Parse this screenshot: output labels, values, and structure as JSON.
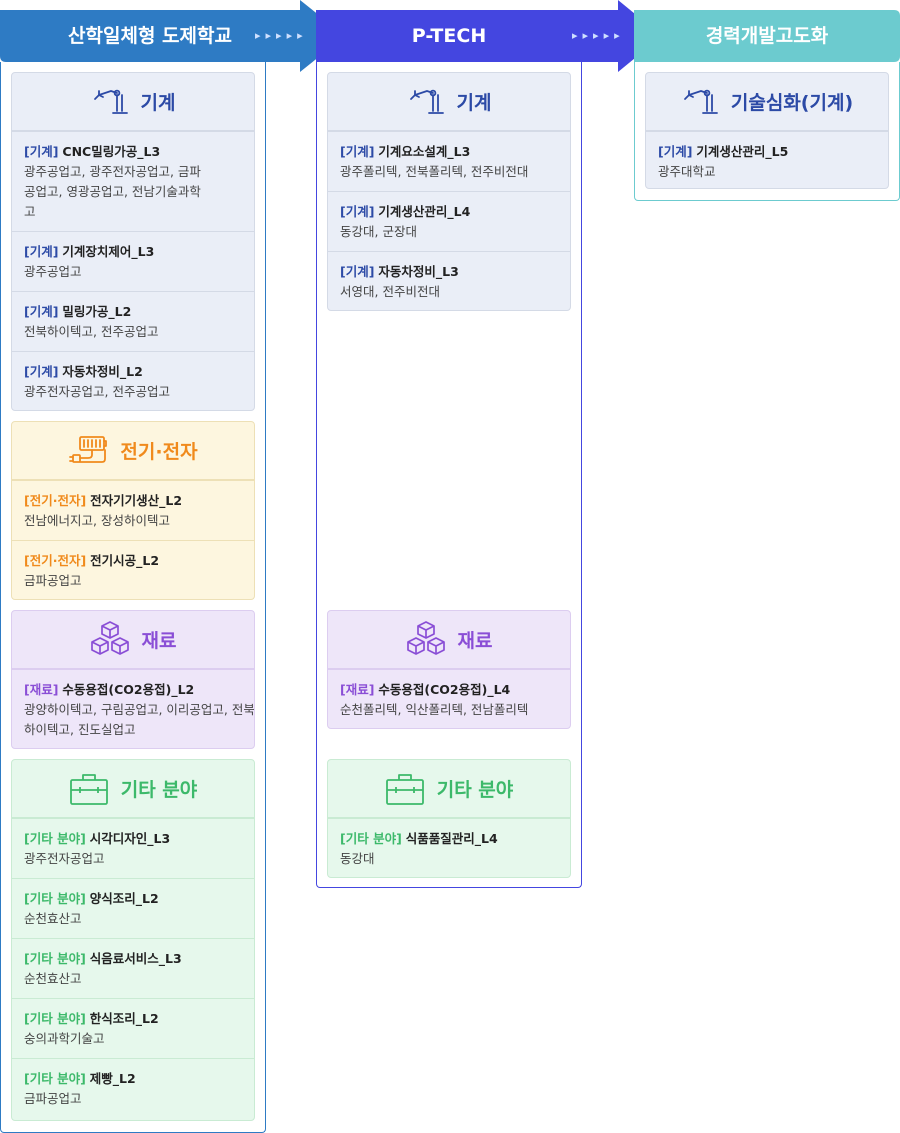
{
  "headers": [
    {
      "label": "산학일체형 도제학교",
      "color": "#2e7bc4"
    },
    {
      "label": "P-TECH",
      "color": "#4446e0"
    },
    {
      "label": "경력개발고도화",
      "color": "#6ccbcf"
    }
  ],
  "arrow_dots": "▸▸▸▸▸",
  "columns": [
    {
      "cards": [
        {
          "category": "기계",
          "icon": "robot-arm-icon",
          "items": [
            {
              "tag": "[기계]",
              "name": "CNC밀링가공_L3",
              "schools": "광주공업고, 광주전자공업고, 금파공업고, 영광공업고, 전남기술과학고"
            },
            {
              "tag": "[기계]",
              "name": "기계장치제어_L3",
              "schools": "광주공업고"
            },
            {
              "tag": "[기계]",
              "name": "밀링가공_L2",
              "schools": "전북하이텍고, 전주공업고"
            },
            {
              "tag": "[기계]",
              "name": "자동차정비_L2",
              "schools": "광주전자공업고, 전주공업고"
            }
          ]
        },
        {
          "category": "전기·전자",
          "icon": "battery-plug-icon",
          "items": [
            {
              "tag": "[전기·전자]",
              "name": "전자기기생산_L2",
              "schools": "전남에너지고, 장성하이텍고"
            },
            {
              "tag": "[전기·전자]",
              "name": "전기시공_L2",
              "schools": "금파공업고"
            }
          ]
        },
        {
          "category": "재료",
          "icon": "cubes-icon",
          "items": [
            {
              "tag": "[재료]",
              "name": "수동용접(CO2용접)_L2",
              "schools": "광양하이텍고, 구림공업고, 이리공업고, 전북하이텍고, 진도실업고"
            }
          ]
        },
        {
          "category": "기타 분야",
          "icon": "toolbox-icon",
          "items": [
            {
              "tag": "[기타 분야]",
              "name": "시각디자인_L3",
              "schools": "광주전자공업고"
            },
            {
              "tag": "[기타 분야]",
              "name": "양식조리_L2",
              "schools": "순천효산고"
            },
            {
              "tag": "[기타 분야]",
              "name": "식음료서비스_L3",
              "schools": "순천효산고"
            },
            {
              "tag": "[기타 분야]",
              "name": "한식조리_L2",
              "schools": "숭의과학기술고"
            },
            {
              "tag": "[기타 분야]",
              "name": "제빵_L2",
              "schools": "금파공업고"
            }
          ]
        }
      ]
    },
    {
      "cards": [
        {
          "category": "기계",
          "icon": "robot-arm-icon",
          "items": [
            {
              "tag": "[기계]",
              "name": "기계요소설계_L3",
              "schools": "광주폴리텍, 전북폴리텍, 전주비전대"
            },
            {
              "tag": "[기계]",
              "name": "기계생산관리_L4",
              "schools": "동강대, 군장대"
            },
            {
              "tag": "[기계]",
              "name": "자동차정비_L3",
              "schools": "서영대, 전주비전대"
            }
          ]
        },
        {
          "category": "재료",
          "icon": "cubes-icon",
          "items": [
            {
              "tag": "[재료]",
              "name": "수동용접(CO2용접)_L4",
              "schools": "순천폴리텍, 익산폴리텍, 전남폴리텍"
            }
          ]
        },
        {
          "category": "기타 분야",
          "icon": "toolbox-icon",
          "items": [
            {
              "tag": "[기타 분야]",
              "name": "식품품질관리_L4",
              "schools": "동강대"
            }
          ]
        }
      ]
    },
    {
      "cards": [
        {
          "category": "기술심화(기계)",
          "icon": "robot-arm-icon",
          "items": [
            {
              "tag": "[기계]",
              "name": "기계생산관리_L5",
              "schools": "광주대학교"
            }
          ]
        }
      ]
    }
  ]
}
